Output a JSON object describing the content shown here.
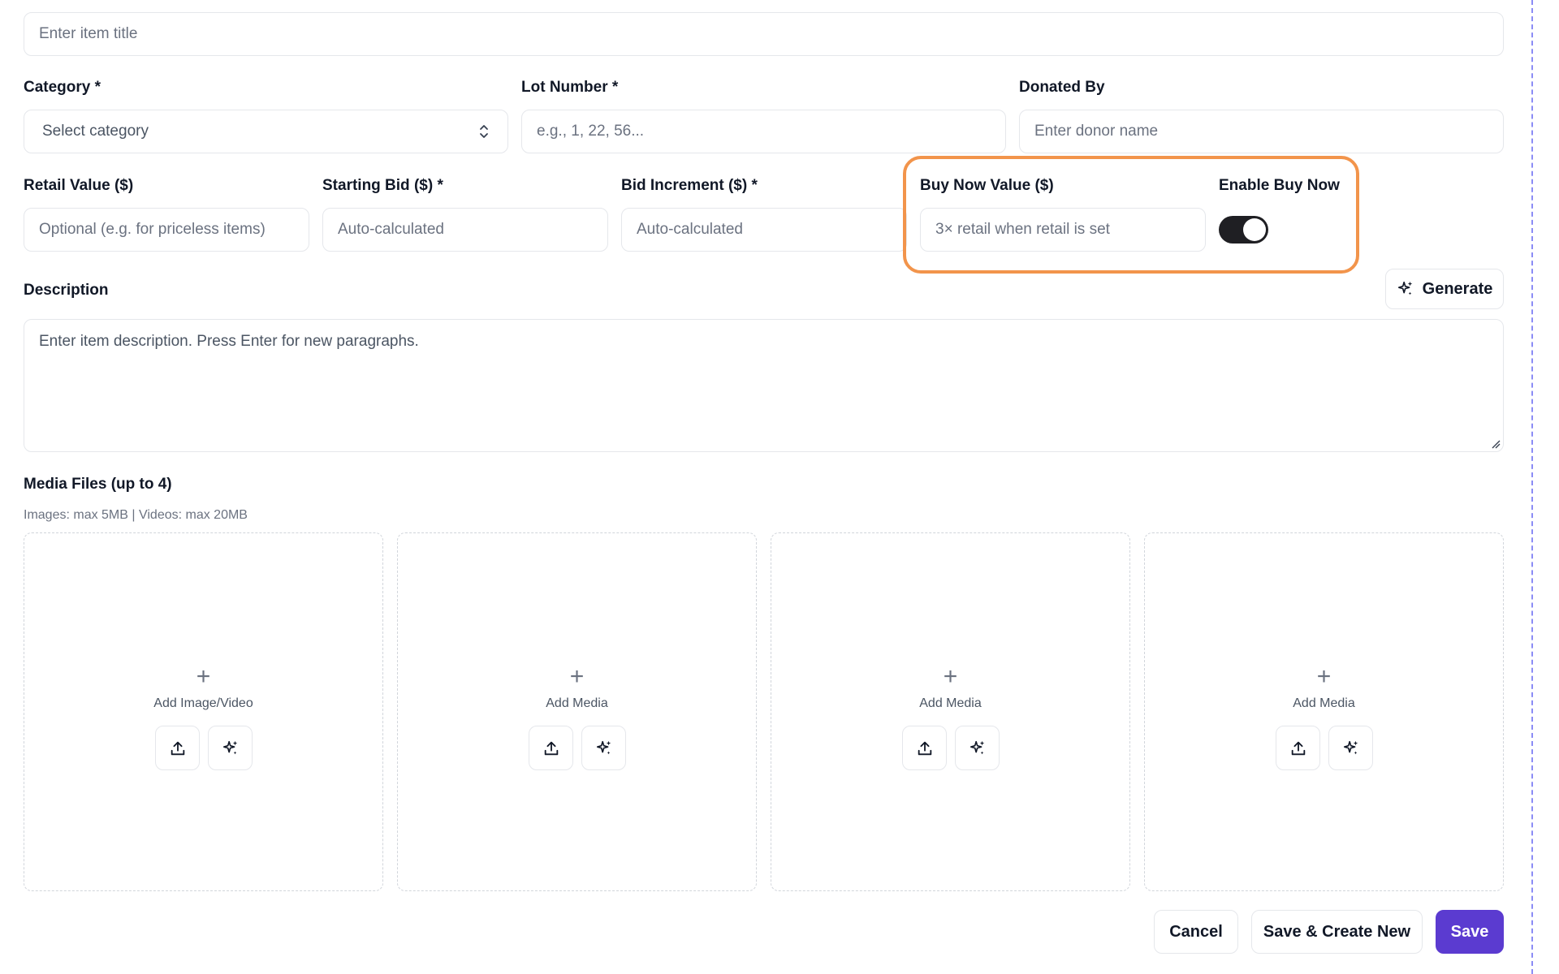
{
  "title_field": {
    "placeholder": "Enter item title"
  },
  "category": {
    "label": "Category *",
    "value": "Select category"
  },
  "lot_number": {
    "label": "Lot Number *",
    "placeholder": "e.g., 1, 22, 56..."
  },
  "donated_by": {
    "label": "Donated By",
    "placeholder": "Enter donor name"
  },
  "retail_value": {
    "label": "Retail Value ($)",
    "placeholder": "Optional (e.g. for priceless items)"
  },
  "starting_bid": {
    "label": "Starting Bid ($) *",
    "placeholder": "Auto-calculated"
  },
  "bid_increment": {
    "label": "Bid Increment ($) *",
    "placeholder": "Auto-calculated"
  },
  "buy_now_value": {
    "label": "Buy Now Value ($)",
    "placeholder": "3× retail when retail is set"
  },
  "enable_buy_now": {
    "label": "Enable Buy Now",
    "enabled": true
  },
  "highlight_color": "#f2944b",
  "description": {
    "label": "Description",
    "generate_label": "Generate",
    "placeholder": "Enter item description. Press Enter for new paragraphs."
  },
  "media": {
    "label": "Media Files (up to 4)",
    "hint": "Images: max 5MB | Videos: max 20MB",
    "slots": [
      {
        "label": "Add Image/Video"
      },
      {
        "label": "Add Media"
      },
      {
        "label": "Add Media"
      },
      {
        "label": "Add Media"
      }
    ]
  },
  "actions": {
    "cancel": "Cancel",
    "save_create_new": "Save & Create New",
    "save": "Save"
  },
  "colors": {
    "accent": "#5b3bd0",
    "toggle_on": "#1f1f23",
    "divider": "#8b8cf5"
  }
}
